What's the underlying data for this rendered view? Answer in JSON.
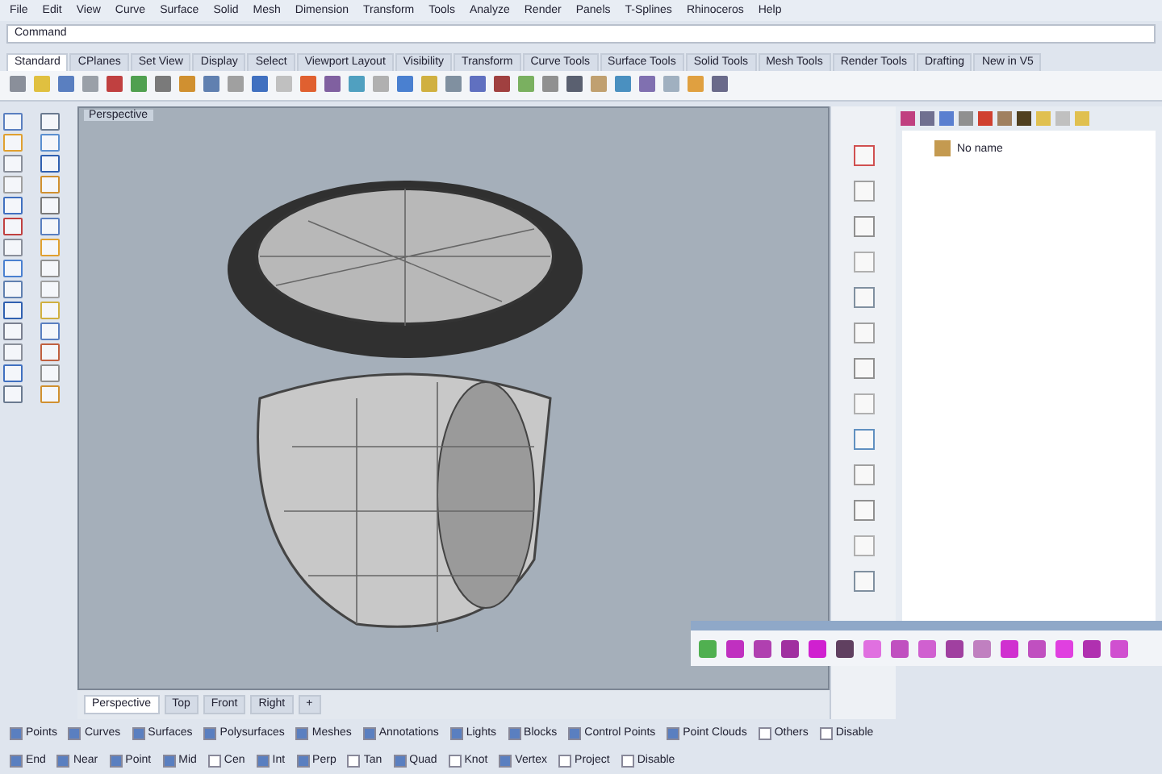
{
  "menu": [
    "File",
    "Edit",
    "View",
    "Curve",
    "Surface",
    "Solid",
    "Mesh",
    "Dimension",
    "Transform",
    "Tools",
    "Analyze",
    "Render",
    "Panels",
    "T-Splines",
    "Rhinoceros",
    "Help"
  ],
  "command": {
    "prompt": "Command"
  },
  "ribbon_tabs": [
    {
      "label": "Standard",
      "selected": true
    },
    {
      "label": "CPlanes",
      "selected": false
    },
    {
      "label": "Set View",
      "selected": false
    },
    {
      "label": "Display",
      "selected": false
    },
    {
      "label": "Select",
      "selected": false
    },
    {
      "label": "Viewport Layout",
      "selected": false
    },
    {
      "label": "Visibility",
      "selected": false
    },
    {
      "label": "Transform",
      "selected": false
    },
    {
      "label": "Curve Tools",
      "selected": false
    },
    {
      "label": "Surface Tools",
      "selected": false
    },
    {
      "label": "Solid Tools",
      "selected": false
    },
    {
      "label": "Mesh Tools",
      "selected": false
    },
    {
      "label": "Render Tools",
      "selected": false
    },
    {
      "label": "Drafting",
      "selected": false
    },
    {
      "label": "New in V5",
      "selected": false
    }
  ],
  "viewport": {
    "title": "Perspective"
  },
  "side_panel": {
    "items": [
      {
        "label": "No name"
      }
    ]
  },
  "view_tabs": [
    {
      "label": "Perspective",
      "selected": true
    },
    {
      "label": "Top",
      "selected": false
    },
    {
      "label": "Front",
      "selected": false
    },
    {
      "label": "Right",
      "selected": false
    },
    {
      "label": "+",
      "selected": false
    }
  ],
  "filters": [
    {
      "label": "Points",
      "checked": true
    },
    {
      "label": "Curves",
      "checked": true
    },
    {
      "label": "Surfaces",
      "checked": true
    },
    {
      "label": "Polysurfaces",
      "checked": true
    },
    {
      "label": "Meshes",
      "checked": true
    },
    {
      "label": "Annotations",
      "checked": true
    },
    {
      "label": "Lights",
      "checked": true
    },
    {
      "label": "Blocks",
      "checked": true
    },
    {
      "label": "Control Points",
      "checked": true
    },
    {
      "label": "Point Clouds",
      "checked": true
    },
    {
      "label": "Others",
      "checked": false
    },
    {
      "label": "Disable",
      "checked": false
    }
  ],
  "osnaps": [
    {
      "label": "End",
      "checked": true
    },
    {
      "label": "Near",
      "checked": true
    },
    {
      "label": "Point",
      "checked": true
    },
    {
      "label": "Mid",
      "checked": true
    },
    {
      "label": "Cen",
      "checked": false
    },
    {
      "label": "Int",
      "checked": true
    },
    {
      "label": "Perp",
      "checked": true
    },
    {
      "label": "Tan",
      "checked": false
    },
    {
      "label": "Quad",
      "checked": true
    },
    {
      "label": "Knot",
      "checked": false
    },
    {
      "label": "Vertex",
      "checked": true
    },
    {
      "label": "Project",
      "checked": false
    },
    {
      "label": "Disable",
      "checked": false
    }
  ]
}
